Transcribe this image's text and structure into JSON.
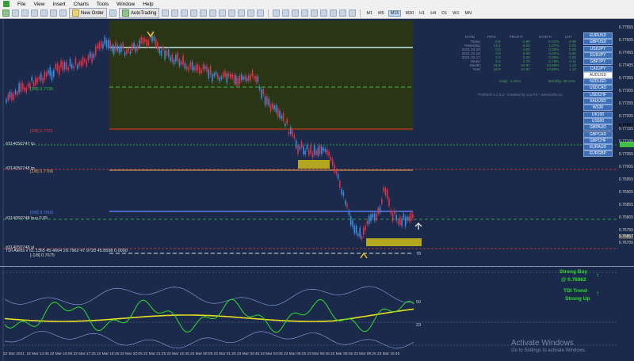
{
  "menu": [
    "File",
    "View",
    "Insert",
    "Charts",
    "Tools",
    "Window",
    "Help"
  ],
  "toolbar": {
    "new_order": "New Order",
    "autotrading": "AutoTrading",
    "timeframes": [
      "M1",
      "M5",
      "M15",
      "M30",
      "H1",
      "H4",
      "D1",
      "W1",
      "MN"
    ]
  },
  "chart": {
    "levels": [
      {
        "text": "[3/8]  0.7736",
        "color": "#3fbf3f"
      },
      {
        "text": "[2/8]  0.7721",
        "color": "#e03a3a"
      },
      {
        "text": "[1/8]  0.7706",
        "color": "#e8a85a"
      },
      {
        "text": "[0/8]  0.7690",
        "color": "#5a7ae8"
      },
      {
        "text": "[-1/8]  0.7675",
        "color": "#d8d8d8"
      }
    ],
    "order_labels": [
      {
        "text": "#314050747 tp",
        "color": "#d8d8d8"
      },
      {
        "text": "#314050748 tp",
        "color": "#d8d8d8"
      },
      {
        "text": "#314050748 buy 0.05",
        "color": "#d8d8d8"
      },
      {
        "text": "#314050748 sl",
        "color": "#d8d8d8"
      }
    ],
    "price_axis": [
      "0.77555",
      "0.77505",
      "0.77455",
      "0.77405",
      "0.77355",
      "0.77305",
      "0.77255",
      "0.77205",
      "0.77155",
      "0.77105",
      "0.77055",
      "0.77005",
      "0.76955",
      "0.76905",
      "0.76855",
      "0.76805",
      "0.76755",
      "0.76705"
    ],
    "current_price": "0.77057",
    "bid_price": "0.76857"
  },
  "symbols": [
    "EURUSD",
    "GBPUSD",
    "USDJPY",
    "EURJPY",
    "GBPJPY",
    "CADJPY",
    "AUDUSD",
    "NZDUSD",
    "USDCAD",
    "USDCHF",
    "XAUUSD",
    "WS30",
    "UK100",
    "US500",
    "GBPAUD",
    "GBPCAD",
    "GBPCHF",
    "EURAUD",
    "EURGBP"
  ],
  "selected_symbol": "AUDUSD",
  "stats": {
    "headers": [
      "DATE",
      "PIPS",
      "PROFIT",
      "GAIN %",
      "LOT"
    ],
    "rows": [
      [
        "Today:",
        "-3.9",
        "-1.90",
        "-0.31%",
        "0.06"
      ],
      [
        "Yesterday:",
        "13.2",
        "6.60",
        "1.07%",
        "0.05"
      ],
      [
        "2021.03.19:",
        "0.0",
        "0.00",
        "0.00%",
        "0.00"
      ],
      [
        "2021.03.18:",
        "0.0",
        "0.00",
        "0.00%",
        "0.00"
      ],
      [
        "2021.03.17:",
        "0.0",
        "0.00",
        "0.00%",
        "0.00"
      ],
      [
        "Week:",
        "9.3",
        "4.70",
        "0.76%",
        "0.11"
      ],
      [
        "Month:",
        "44.9",
        "44.97",
        "24.89%",
        "1.13"
      ],
      [
        "Year:",
        "44.9",
        "44.97",
        "24.89%",
        "1.13"
      ]
    ],
    "daily": "Daily: -1.91%",
    "monthly": "Monthly: 48.13%",
    "credit": "ProfitInfo v.1.5.2 - Created by 1ca.FX - www.icafx.eu"
  },
  "indicator": {
    "title": "TDI Alerts v 61.1365 45.4664 29.7962 47.9728 45.8598 0.0000",
    "levels": [
      "78",
      "50",
      "23"
    ],
    "signals": [
      {
        "line1": "Strong Buy",
        "line2": "@ 0.76862"
      },
      {
        "line1": "TDI Trend",
        "line2": "Strong Up"
      }
    ]
  },
  "time_axis": [
    "22 Mar 2021",
    "22 Mar 14:45",
    "22 Mar 16:05",
    "22 Mar 17:25",
    "22 Mar 18:45",
    "22 Mar 20:05",
    "22 Mar 21:25",
    "22 Mar 22:45",
    "23 Mar 00:05",
    "23 Mar 01:25",
    "23 Mar 02:45",
    "23 Mar 04:05",
    "23 Mar 05:25",
    "23 Mar 06:45",
    "23 Mar 08:05",
    "23 Mar 09:25",
    "23 Mar 10:45"
  ],
  "watermark": {
    "title": "Activate Windows",
    "sub": "Go to Settings to activate Windows."
  },
  "colors": {
    "bg": "#1b2a4a",
    "bull": "#3a8be0",
    "bear": "#e0304a",
    "zone": "#2a3516"
  }
}
